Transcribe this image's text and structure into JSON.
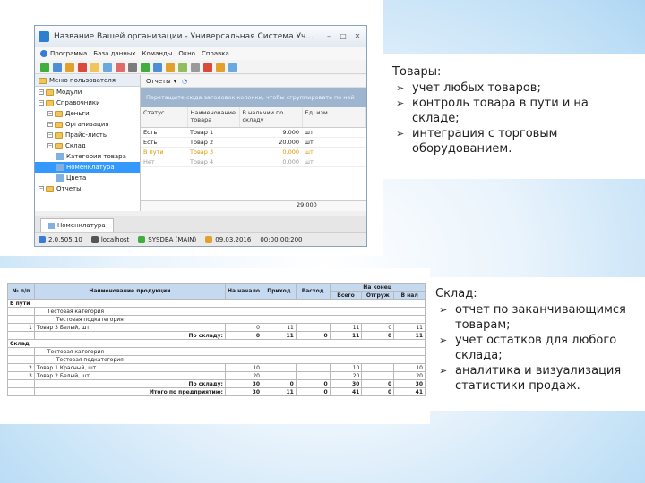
{
  "window": {
    "title": "Название Вашей организации - Универсальная Система Уч...",
    "controls": [
      "–",
      "□",
      "✕"
    ],
    "menu": [
      "Программа",
      "База данных",
      "Команды",
      "Окно",
      "Справка"
    ],
    "left_panel_title": "Меню пользователя",
    "tree": [
      {
        "label": "Модули",
        "indent": 0,
        "type": "folder"
      },
      {
        "label": "Справочники",
        "indent": 0,
        "type": "folder"
      },
      {
        "label": "Деньги",
        "indent": 1,
        "type": "folder"
      },
      {
        "label": "Организация",
        "indent": 1,
        "type": "folder"
      },
      {
        "label": "Прайс-листы",
        "indent": 1,
        "type": "folder"
      },
      {
        "label": "Склад",
        "indent": 1,
        "type": "folder"
      },
      {
        "label": "Категории товара",
        "indent": 2,
        "type": "leaf"
      },
      {
        "label": "Номенклатура",
        "indent": 2,
        "type": "leaf",
        "selected": true
      },
      {
        "label": "Цвета",
        "indent": 2,
        "type": "leaf"
      },
      {
        "label": "Отчеты",
        "indent": 0,
        "type": "folder"
      }
    ],
    "reports_button": "Отчеты",
    "group_hint": "Перетащите сюда заголовок колонки, чтобы сгруппировать по ней",
    "columns": [
      "Статус",
      "Наименование товара",
      "В наличии по складу",
      "Ед. изм."
    ],
    "rows": [
      {
        "status": "Есть",
        "name": "Товар 1",
        "qty": "9.000",
        "unit": "шт",
        "color": "#222"
      },
      {
        "status": "Есть",
        "name": "Товар 2",
        "qty": "20.000",
        "unit": "шт",
        "color": "#222"
      },
      {
        "status": "В пути",
        "name": "Товар 3",
        "qty": "0.000",
        "unit": "шт",
        "color": "#d89a00"
      },
      {
        "status": "Нет",
        "name": "Товар 4",
        "qty": "0.000",
        "unit": "шт",
        "color": "#999"
      }
    ],
    "total": "29.000",
    "tab": "Номенклатура",
    "status_bar": [
      "2.0.505.10",
      "localhost",
      "SYSDBA (MAIN)",
      "09.03.2016",
      "00:00:00:200"
    ]
  },
  "report": {
    "headers": {
      "num": "№ п/п",
      "name": "Наименование продукции",
      "start": "На начало",
      "income": "Приход",
      "outcome": "Расход",
      "end": "На конец",
      "end_total": "Всего",
      "end_ship": "Отгруж",
      "end_stock": "В нал"
    },
    "rows": [
      {
        "kind": "section",
        "name": "В пути"
      },
      {
        "kind": "cat",
        "name": "Тестовая категория"
      },
      {
        "kind": "subcat",
        "name": "Тестовая подкатегория"
      },
      {
        "kind": "item",
        "num": "1",
        "name": "Товар 3 Белый, шт",
        "start": "0",
        "income": "11",
        "outcome": "",
        "total": "11",
        "ship": "0",
        "stock": "11"
      },
      {
        "kind": "sum",
        "name": "По складу:",
        "start": "0",
        "income": "11",
        "outcome": "0",
        "total": "11",
        "ship": "0",
        "stock": "11"
      },
      {
        "kind": "section",
        "name": "Склад"
      },
      {
        "kind": "cat",
        "name": "Тестовая категория"
      },
      {
        "kind": "subcat",
        "name": "Тестовая подкатегория"
      },
      {
        "kind": "item",
        "num": "2",
        "name": "Товар 1 Красный, шт",
        "start": "10",
        "income": "",
        "outcome": "",
        "total": "10",
        "ship": "",
        "stock": "10"
      },
      {
        "kind": "item",
        "num": "3",
        "name": "Товар 2 Белый, шт",
        "start": "20",
        "income": "",
        "outcome": "",
        "total": "20",
        "ship": "",
        "stock": "20"
      },
      {
        "kind": "sum",
        "name": "По складу:",
        "start": "30",
        "income": "0",
        "outcome": "0",
        "total": "30",
        "ship": "0",
        "stock": "30"
      },
      {
        "kind": "sum",
        "name": "Итого по предприятию:",
        "start": "30",
        "income": "11",
        "outcome": "0",
        "total": "41",
        "ship": "0",
        "stock": "41"
      }
    ]
  },
  "goods_text": {
    "heading": "Товары:",
    "items": [
      "учет любых товаров;",
      "контроль товара в пути и на складе;",
      "интеграция с торговым оборудованием."
    ]
  },
  "warehouse_text": {
    "heading": "Склад:",
    "items": [
      "отчет по заканчивающимся товарам;",
      "учет остатков для любого склада;",
      "аналитика и визуализация статистики продаж."
    ]
  }
}
